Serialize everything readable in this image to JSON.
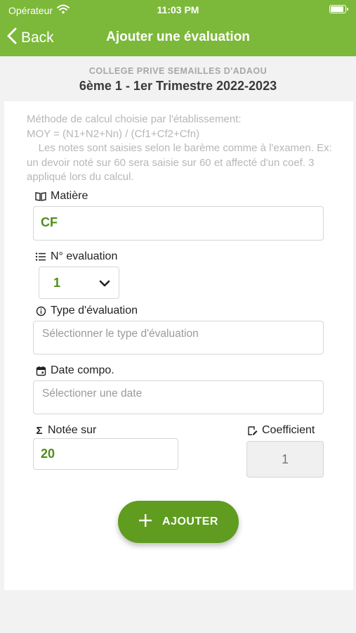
{
  "status": {
    "carrier": "Opérateur",
    "time": "11:03 PM",
    "battery_level": 0.9
  },
  "nav": {
    "back_label": "Back",
    "title": "Ajouter une évaluation"
  },
  "header": {
    "school": "COLLEGE PRIVE SEMAILLES D'ADAOU",
    "class_period": "6ème 1 - 1er Trimestre 2022-2023"
  },
  "info": {
    "line1": "Méthode de calcul choisie par l'établissement:",
    "line2": "MOY = (N1+N2+Nn) / (Cf1+Cf2+Cfn)",
    "line3": "    Les notes sont saisies selon le barème comme à l'examen. Ex: un devoir noté sur 60 sera saisie sur 60 et affecté d'un coef. 3 appliqué lors du calcul."
  },
  "form": {
    "matiere_label": "Matière",
    "matiere_value": "CF",
    "numero_label": "N° evaluation",
    "numero_value": "1",
    "type_label": "Type d'évaluation",
    "type_placeholder": "Sélectionner le type d'évaluation",
    "date_label": "Date compo.",
    "date_placeholder": "Sélectioner une date",
    "notee_label": "Notée sur",
    "notee_value": "20",
    "coef_label": "Coefficient",
    "coef_value": "1"
  },
  "actions": {
    "add_label": "AJOUTER"
  },
  "colors": {
    "primary": "#7cb83a",
    "button": "#5f9c1f",
    "value_text": "#4f8d1a"
  }
}
